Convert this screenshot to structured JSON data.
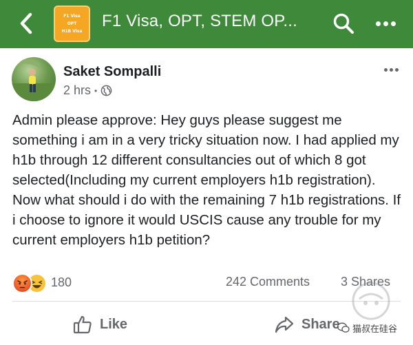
{
  "header": {
    "group_title": "F1 Visa, OPT, STEM OP...",
    "group_logo_lines": [
      "F1 Visa",
      "OPT",
      "H1B Visa"
    ],
    "colors": {
      "bar": "#3e8a3a",
      "logo": "#f5a623"
    }
  },
  "post": {
    "author": "Saket Sompalli",
    "time": "2 hrs",
    "privacy_icon": "globe-icon",
    "body": "Admin please approve: Hey guys please suggest me something i am in a very tricky situation now. I had applied my h1b through 12 different consultancies out of which 8 got selected(Including my current employers h1b registration). Now what should i do with the remaining 7 h1b registrations. If i choose to ignore it would USCIS cause any trouble for my current employers h1b petition?"
  },
  "stats": {
    "reaction_icons": [
      "angry-reaction-icon",
      "haha-reaction-icon"
    ],
    "reaction_count": "180",
    "comments": "242 Comments",
    "shares": "3 Shares"
  },
  "actions": {
    "like_label": "Like",
    "share_label": "Share"
  },
  "watermark": {
    "text": "猫叔在硅谷"
  }
}
